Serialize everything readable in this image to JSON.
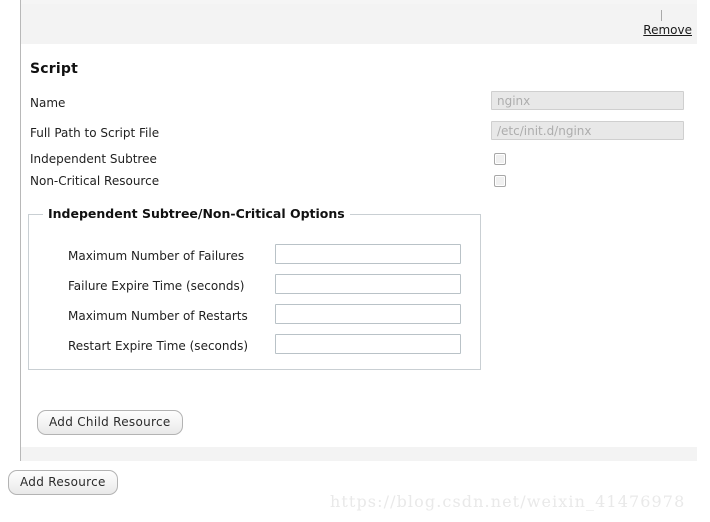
{
  "panel": {
    "remove_label": "Remove",
    "section_title": "Script"
  },
  "form": {
    "rows": [
      {
        "label": "Name",
        "control": "text",
        "value": "nginx"
      },
      {
        "label": "Full Path to Script File",
        "control": "text",
        "value": "/etc/init.d/nginx"
      },
      {
        "label": "Independent Subtree",
        "control": "checkbox",
        "checked": false
      },
      {
        "label": "Non-Critical Resource",
        "control": "checkbox",
        "checked": false
      }
    ]
  },
  "options_fieldset": {
    "legend": "Independent Subtree/Non-Critical Options",
    "rows": [
      {
        "label": "Maximum Number of Failures",
        "value": ""
      },
      {
        "label": "Failure Expire Time (seconds)",
        "value": ""
      },
      {
        "label": "Maximum Number of Restarts",
        "value": ""
      },
      {
        "label": "Restart Expire Time (seconds)",
        "value": ""
      }
    ]
  },
  "buttons": {
    "add_child_resource": "Add Child Resource",
    "add_resource": "Add Resource"
  },
  "watermark": {
    "text": "https://blog.csdn.net/weixin_41476978"
  },
  "colors": {
    "panel_strip": "#f3f3f3",
    "field_disabled_bg": "#e8e8e8",
    "fieldset_border": "#c9cfd3",
    "text": "#1a1a1a"
  }
}
